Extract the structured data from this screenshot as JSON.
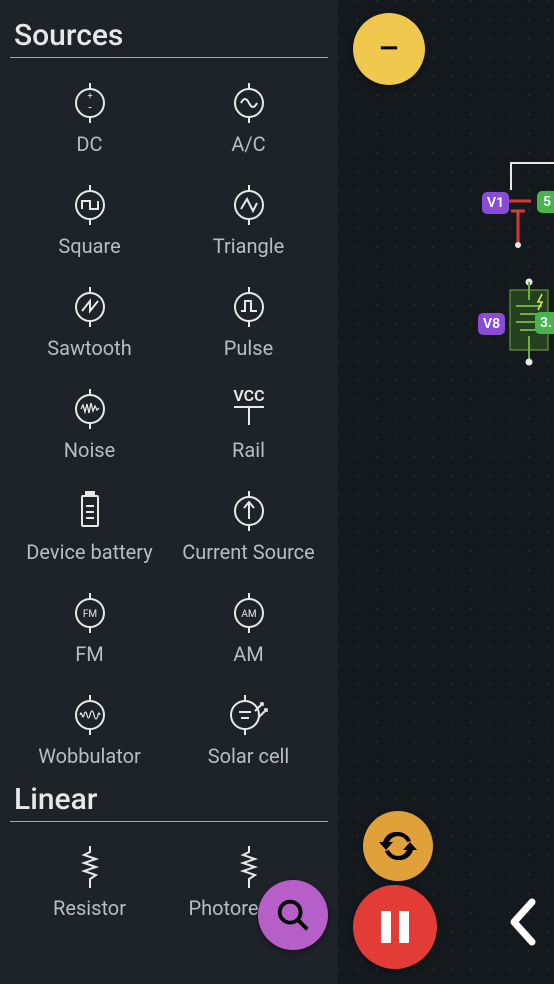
{
  "sections": [
    {
      "title": "Sources",
      "items": [
        {
          "id": "dc",
          "label": "DC"
        },
        {
          "id": "ac",
          "label": "A/C"
        },
        {
          "id": "square",
          "label": "Square"
        },
        {
          "id": "triangle",
          "label": "Triangle"
        },
        {
          "id": "sawtooth",
          "label": "Sawtooth"
        },
        {
          "id": "pulse",
          "label": "Pulse"
        },
        {
          "id": "noise",
          "label": "Noise"
        },
        {
          "id": "rail",
          "label": "Rail",
          "rail_text": "VCC"
        },
        {
          "id": "device-battery",
          "label": "Device battery"
        },
        {
          "id": "current-source",
          "label": "Current Source"
        },
        {
          "id": "fm",
          "label": "FM",
          "inner_text": "FM"
        },
        {
          "id": "am",
          "label": "AM",
          "inner_text": "AM"
        },
        {
          "id": "wobbulator",
          "label": "Wobbulator"
        },
        {
          "id": "solar-cell",
          "label": "Solar cell"
        }
      ]
    },
    {
      "title": "Linear",
      "items": [
        {
          "id": "resistor",
          "label": "Resistor"
        },
        {
          "id": "photoresistor",
          "label": "Photoresistor"
        }
      ]
    }
  ],
  "canvas": {
    "labels": {
      "v1": "V1",
      "v8": "V8",
      "g1": "5",
      "g2": "3."
    },
    "zoom_glyph": "−"
  }
}
